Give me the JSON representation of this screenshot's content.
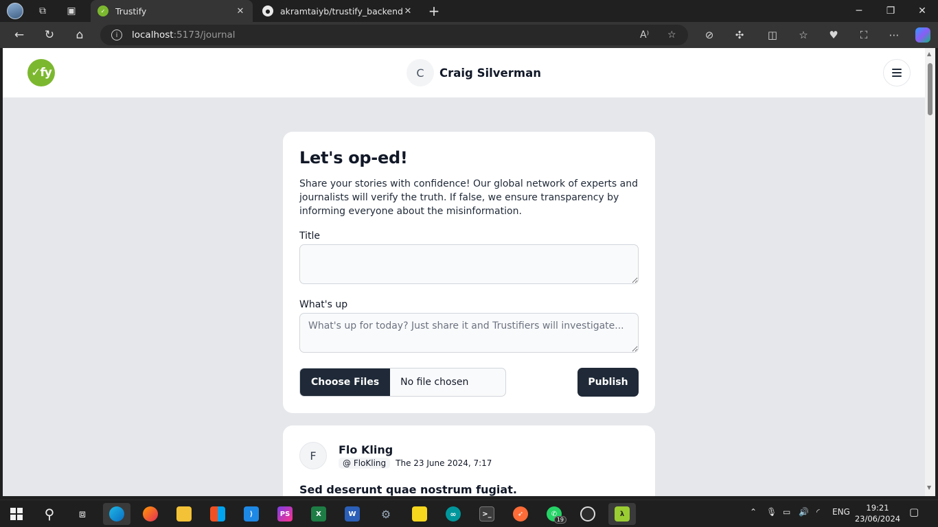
{
  "browser": {
    "tabs": [
      {
        "title": "Trustify",
        "active": true
      },
      {
        "title": "akramtaiyb/trustify_backend",
        "active": false
      }
    ],
    "address": {
      "host": "localhost",
      "path": ":5173/journal"
    }
  },
  "app": {
    "logo_text": "✓fy",
    "user": {
      "initial": "C",
      "name": "Craig Silverman"
    }
  },
  "compose": {
    "heading": "Let's op-ed!",
    "lead": "Share your stories with confidence! Our global network of experts and journalists will verify the truth. If false, we ensure transparency by informing everyone about the misinformation.",
    "title_label": "Title",
    "title_value": "",
    "body_label": "What's up",
    "body_placeholder": "What's up for today? Just share it and Trustifiers will investigate...",
    "choose_files": "Choose Files",
    "no_file": "No file chosen",
    "publish": "Publish"
  },
  "post": {
    "initial": "F",
    "author": "Flo Kling",
    "handle": "@ FloKling",
    "date": "The 23 June 2024, 7:17",
    "title": "Sed deserunt quae nostrum fugiat."
  },
  "taskbar": {
    "language": "ENG",
    "time": "19:21",
    "date": "23/06/2024",
    "whatsapp_badge": "19"
  },
  "colors": {
    "brand": "#7cb82f",
    "dark_button": "#1f2937",
    "page_bg": "#e5e7eb"
  }
}
